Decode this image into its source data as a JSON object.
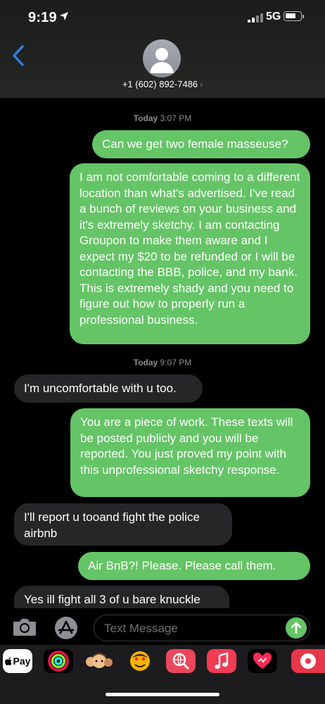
{
  "status_bar": {
    "time": "9:19",
    "network": "5G"
  },
  "header": {
    "contact": "+1 (602) 892-7486",
    "chevron": "›"
  },
  "messages": {
    "ts1_day": "Today",
    "ts1_time": "3:07 PM",
    "m1": "Can we get two female masseuse?",
    "m2": "I am not comfortable coming to a different location than what's advertised.  I've read a bunch of reviews on your business and it's extremely sketchy.  I am contacting Groupon to make them aware and I expect my $20 to be refunded or I will be contacting the BBB, police, and my bank.  This is extremely shady and you need to figure out how to properly run a professional business.",
    "ts2_day": "Today",
    "ts2_time": "9:07 PM",
    "m3": "I'm uncomfortable with u too.",
    "m4": "You are a piece of work.  These texts will be posted publicly and you will be reported.  You just proved my point with this unprofessional sketchy response.",
    "m5": "I'll report u tooand fight the police airbnb",
    "m6": "Air BnB?!  Please.  Please call them.",
    "m7": "Yes ill fight all 3 of u bare knuckle"
  },
  "input": {
    "placeholder": "Text Message"
  },
  "app_strip": {
    "apple_pay": "Pay",
    "items": [
      "apple-pay",
      "activity",
      "memoji",
      "animoji",
      "image-search",
      "music",
      "digital-touch",
      "more"
    ]
  },
  "colors": {
    "outgoing": "#65c466",
    "incoming": "#262628",
    "background": "#000000",
    "secondary_text": "#8e8e93"
  }
}
